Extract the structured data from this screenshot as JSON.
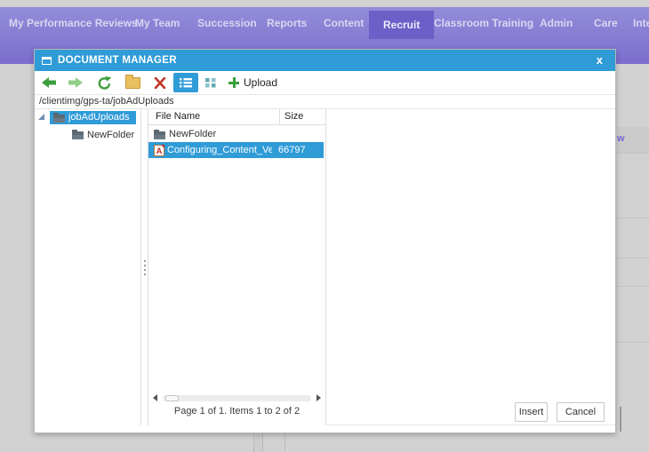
{
  "nav": {
    "items": [
      {
        "label": "My Performance Reviews"
      },
      {
        "label": "My Team"
      },
      {
        "label": "Succession"
      },
      {
        "label": "Reports"
      },
      {
        "label": "Content"
      },
      {
        "label": "Recruit"
      },
      {
        "label": "Classroom Training"
      },
      {
        "label": "Admin"
      },
      {
        "label": "Care"
      },
      {
        "label": "Inte"
      }
    ],
    "active_item": "Recruit"
  },
  "dialog": {
    "title": "DOCUMENT MANAGER",
    "close_label": "x",
    "toolbar": {
      "upload_label": "Upload",
      "icons": [
        "back-arrow",
        "forward-arrow",
        "refresh",
        "new-folder",
        "delete",
        "list-view",
        "grid-view",
        "upload-plus"
      ]
    },
    "path": "/clientimg/gps-ta/jobAdUploads",
    "tree": {
      "root_label": "jobAdUploads",
      "child_label": "NewFolder"
    },
    "list": {
      "columns": {
        "name": "File Name",
        "size": "Size"
      },
      "rows": [
        {
          "name": "NewFolder",
          "size": "",
          "type": "folder",
          "selected": false
        },
        {
          "name": "Configuring_Content_Vendo",
          "size": "66797",
          "type": "pdf",
          "selected": true
        }
      ]
    },
    "pagination": "Page 1 of 1. Items 1 to 2 of 2",
    "buttons": {
      "insert": "Insert",
      "cancel": "Cancel"
    }
  },
  "background": {
    "link_fragment": "w"
  },
  "colors": {
    "titlebar_blue": "#2f9bd7",
    "selection_blue": "#2f9bd7",
    "nav_purple": "#867cd3",
    "nav_active_purple": "#6d5fc7",
    "background_gray": "#d2d2d2",
    "green_icon": "#3c9e3c",
    "red_icon": "#c0392b"
  }
}
